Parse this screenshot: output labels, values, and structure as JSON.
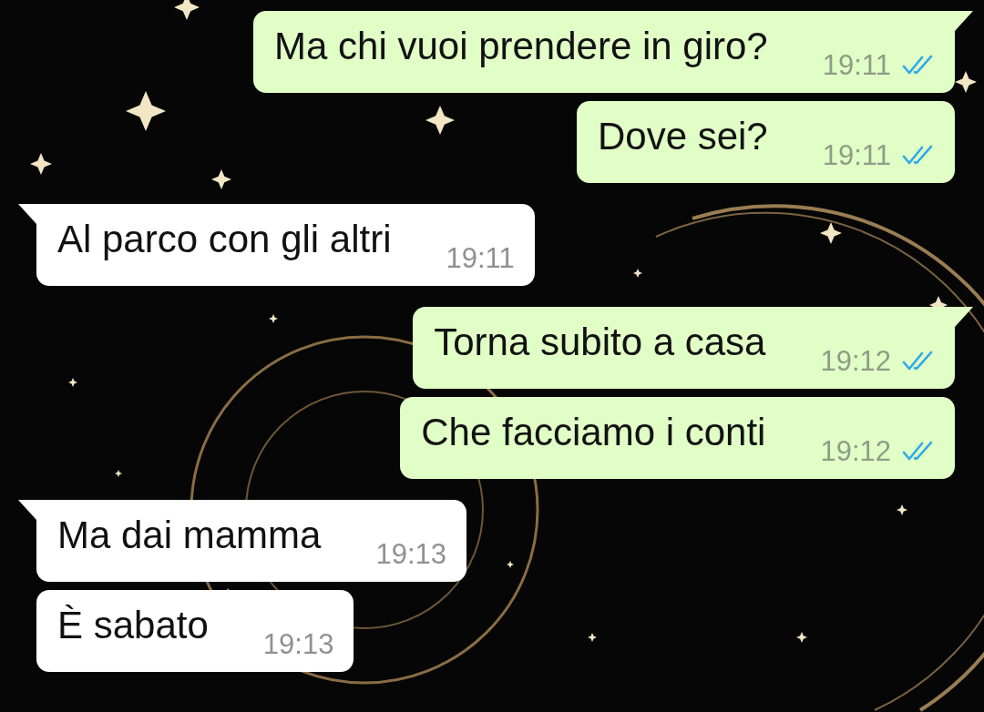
{
  "messages": [
    {
      "kind": "sent",
      "text": "Ma chi vuoi prendere in giro?",
      "time": "19:11",
      "read": true,
      "tail": true
    },
    {
      "kind": "sent",
      "text": "Dove sei?",
      "time": "19:11",
      "read": true,
      "tail": false
    },
    {
      "kind": "received",
      "text": "Al parco con gli altri",
      "time": "19:11",
      "tail": true
    },
    {
      "kind": "sent",
      "text": "Torna subito a casa",
      "time": "19:12",
      "read": true,
      "tail": true
    },
    {
      "kind": "sent",
      "text": "Che facciamo i conti",
      "time": "19:12",
      "read": true,
      "tail": false
    },
    {
      "kind": "received",
      "text": "Ma dai mamma",
      "time": "19:13",
      "tail": true
    },
    {
      "kind": "received",
      "text": "È sabato",
      "time": "19:13",
      "tail": false
    }
  ]
}
